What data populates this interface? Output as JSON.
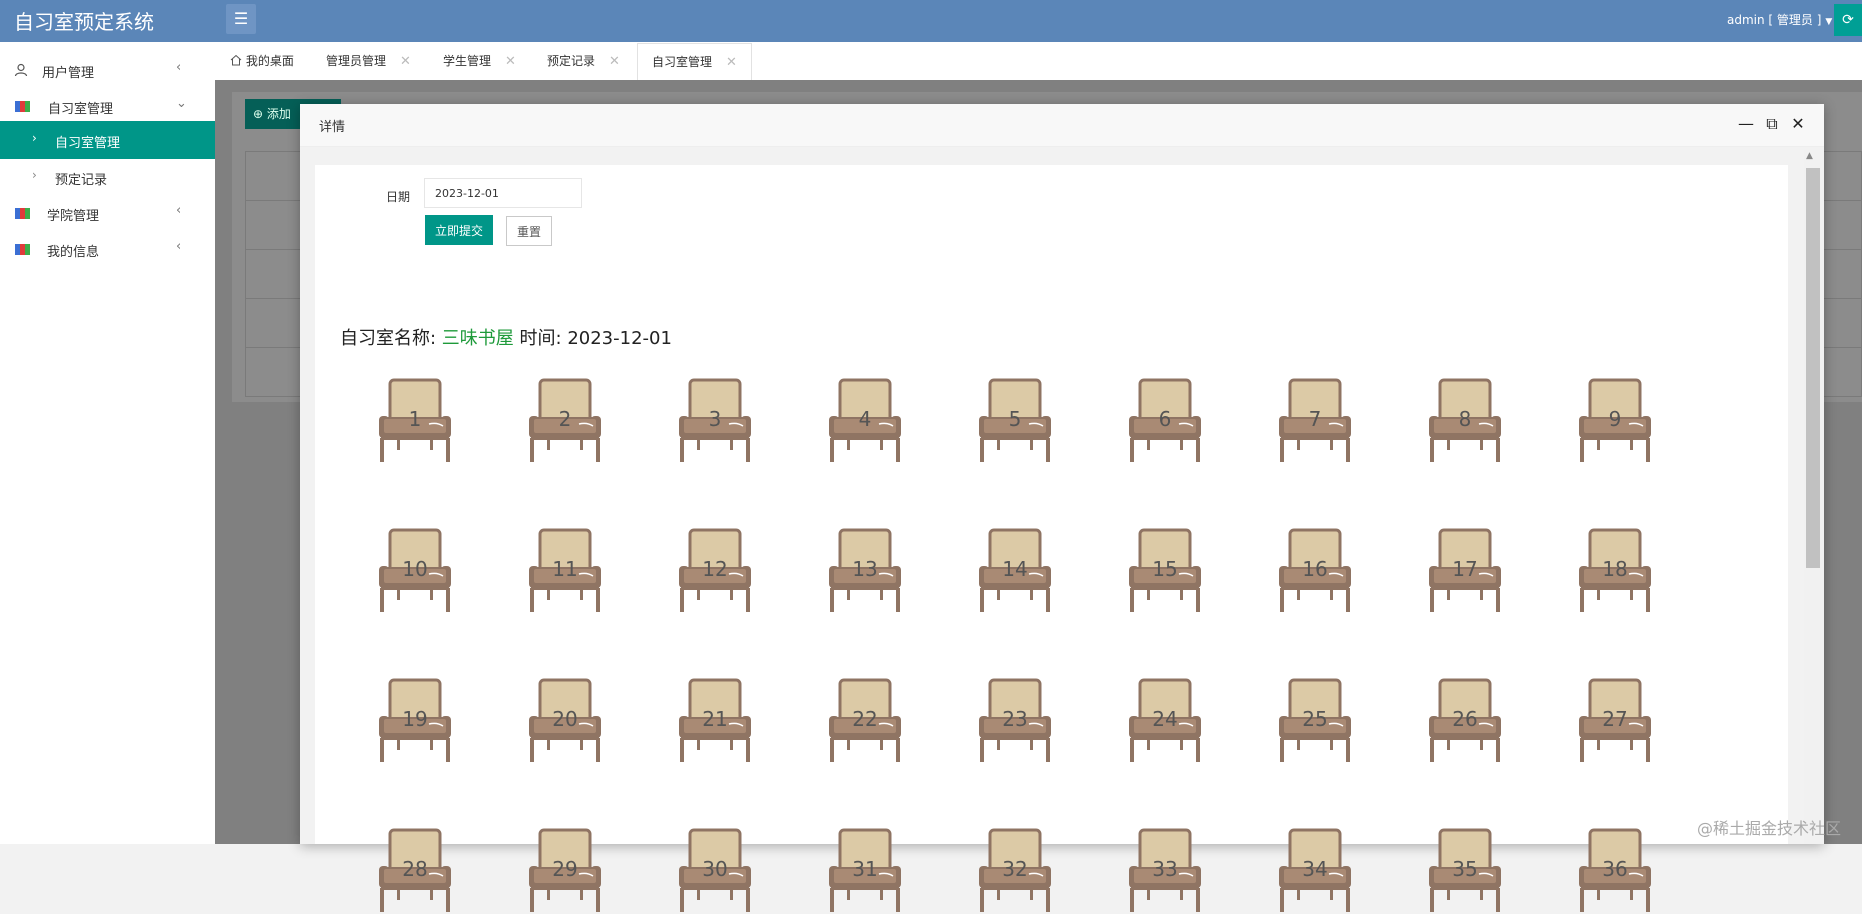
{
  "app_title": "自习室预定系统",
  "header": {
    "user_label": "admin [ 管理员 ]"
  },
  "sidebar": {
    "items": [
      {
        "label": "用户管理",
        "type": "group",
        "expanded": false
      },
      {
        "label": "自习室管理",
        "type": "group",
        "expanded": true
      },
      {
        "label": "自习室管理",
        "type": "child",
        "active": true
      },
      {
        "label": "预定记录",
        "type": "child",
        "active": false
      },
      {
        "label": "学院管理",
        "type": "group",
        "expanded": false
      },
      {
        "label": "我的信息",
        "type": "group",
        "expanded": false
      }
    ]
  },
  "tabs": [
    {
      "label": "我的桌面",
      "icon": "home-icon"
    },
    {
      "label": "管理员管理"
    },
    {
      "label": "学生管理"
    },
    {
      "label": "预定记录"
    },
    {
      "label": "自习室管理",
      "active": true
    }
  ],
  "background_page": {
    "add_button_label": "添加"
  },
  "modal": {
    "title": "详情",
    "form": {
      "date_label": "日期",
      "date_value": "2023-12-01",
      "submit_label": "立即提交",
      "reset_label": "重置"
    },
    "room_line": {
      "prefix": "自习室名称: ",
      "room_name": "三味书屋",
      "time_prefix": " 时间: ",
      "time_value": "2023-12-01"
    },
    "seats": [
      "1",
      "2",
      "3",
      "4",
      "5",
      "6",
      "7",
      "8",
      "9",
      "10",
      "11",
      "12",
      "13",
      "14",
      "15",
      "16",
      "17",
      "18",
      "19",
      "20",
      "21",
      "22",
      "23",
      "24",
      "25",
      "26",
      "27",
      "28",
      "29",
      "30",
      "31",
      "32",
      "33",
      "34",
      "35",
      "36"
    ]
  },
  "watermark": "@稀土掘金技术社区",
  "colors": {
    "header": "#5b86b8",
    "accent": "#009688",
    "room_name": "#1e9a3a",
    "chair_back": "#dccaa6",
    "chair_frame": "#8f7463"
  }
}
